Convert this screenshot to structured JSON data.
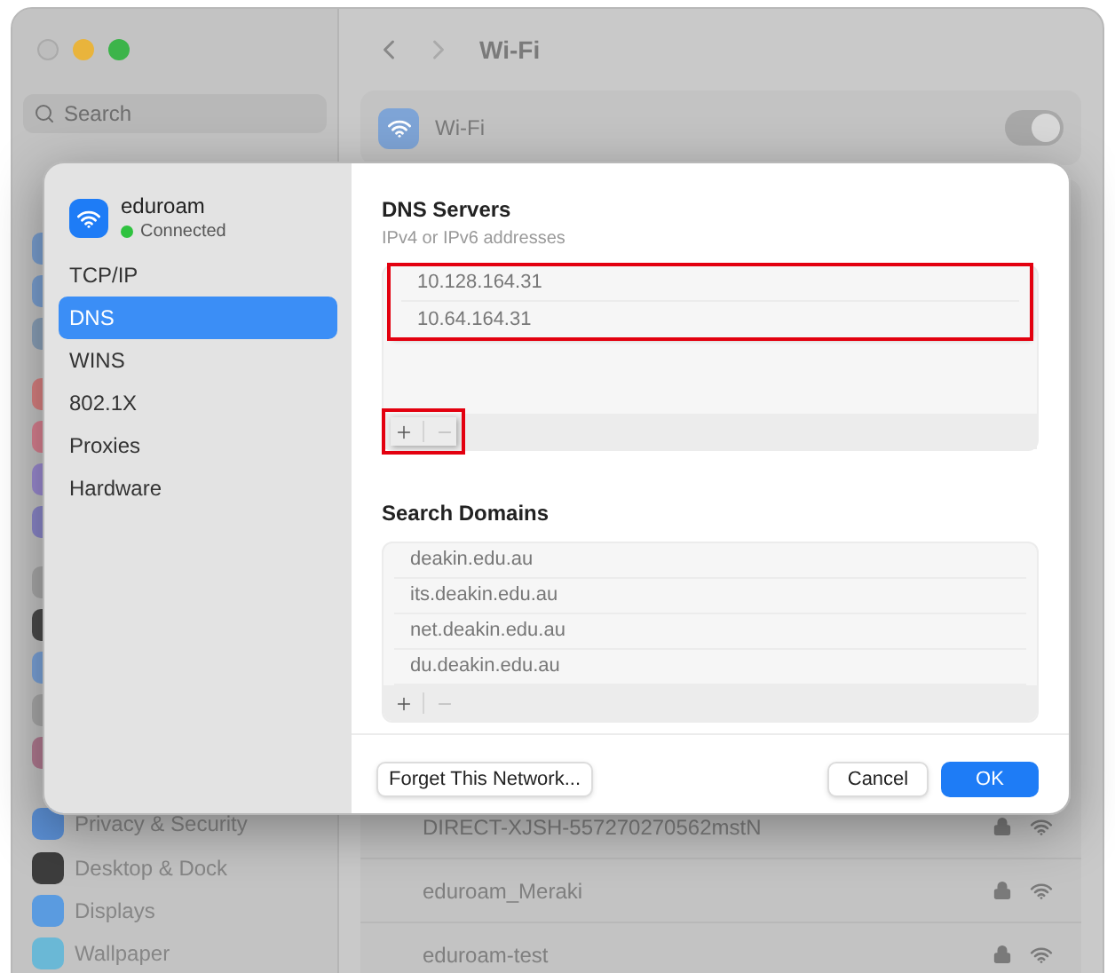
{
  "window": {
    "title": "Wi-Fi"
  },
  "sidebar": {
    "search": {
      "placeholder": "Search"
    },
    "items": [
      {
        "label": "Privacy & Security",
        "color": "#5b8fd4"
      },
      {
        "label": "Desktop & Dock",
        "color": "#3d3d3d"
      },
      {
        "label": "Displays",
        "color": "#5a9be0"
      },
      {
        "label": "Wallpaper",
        "color": "#6ab8d6"
      }
    ]
  },
  "wifi": {
    "label": "Wi-Fi",
    "on": true
  },
  "networks": [
    {
      "name": "DIRECT-XJSH-557270270562mstN",
      "locked": true
    },
    {
      "name": "eduroam_Meraki",
      "locked": true
    },
    {
      "name": "eduroam-test",
      "locked": true
    }
  ],
  "sheet": {
    "network": {
      "name": "eduroam",
      "status": "Connected",
      "connected": true
    },
    "tabs": [
      {
        "label": "TCP/IP",
        "selected": false
      },
      {
        "label": "DNS",
        "selected": true
      },
      {
        "label": "WINS",
        "selected": false
      },
      {
        "label": "802.1X",
        "selected": false
      },
      {
        "label": "Proxies",
        "selected": false
      },
      {
        "label": "Hardware",
        "selected": false
      }
    ],
    "dns": {
      "title": "DNS Servers",
      "subtitle": "IPv4 or IPv6 addresses",
      "servers": [
        "10.128.164.31",
        "10.64.164.31"
      ],
      "servers_highlighted": true,
      "controls_highlighted": true
    },
    "search_domains": {
      "title": "Search Domains",
      "domains": [
        "deakin.edu.au",
        "its.deakin.edu.au",
        "net.deakin.edu.au",
        "du.deakin.edu.au"
      ]
    },
    "buttons": {
      "forget": "Forget This Network...",
      "cancel": "Cancel",
      "ok": "OK"
    }
  }
}
